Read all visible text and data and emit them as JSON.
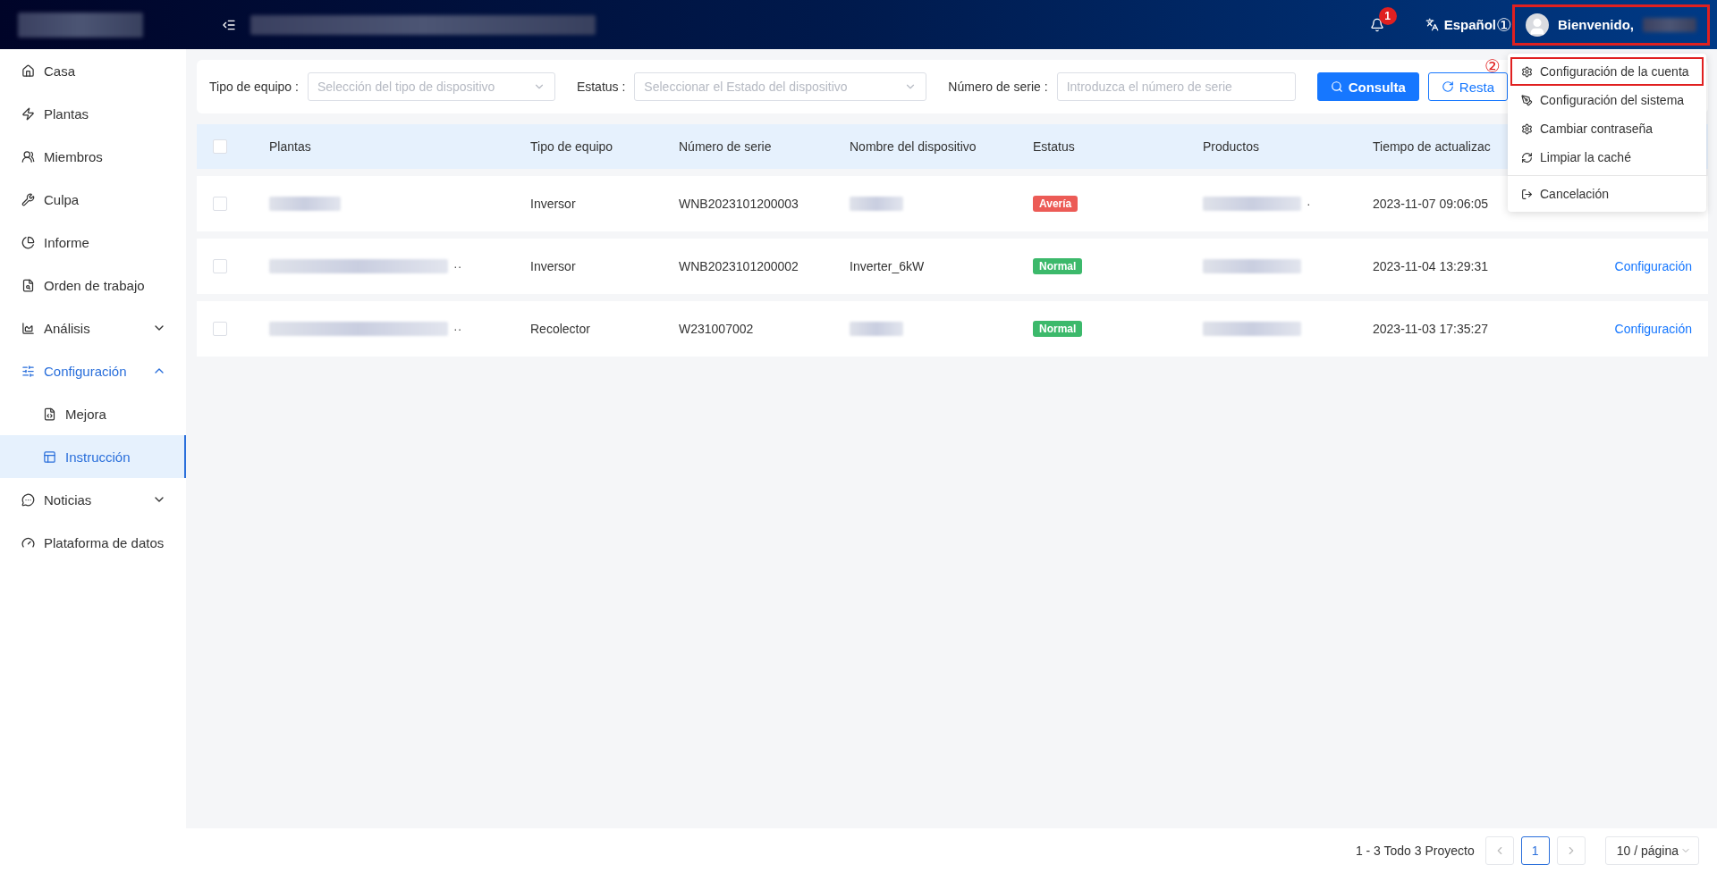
{
  "header": {
    "notification_count": "1",
    "language": "Español",
    "welcome": "Bienvenido,",
    "user_marked": true,
    "annotation_user": "①"
  },
  "sidebar": {
    "items": [
      {
        "label": "Casa",
        "selected": false
      },
      {
        "label": "Plantas",
        "selected": false
      },
      {
        "label": "Miembros",
        "selected": false
      },
      {
        "label": "Culpa",
        "selected": false
      },
      {
        "label": "Informe",
        "selected": false
      },
      {
        "label": "Orden de trabajo",
        "selected": false
      },
      {
        "label": "Análisis",
        "selected": false,
        "expanded": false
      },
      {
        "label": "Configuración",
        "selected": true,
        "expanded": true,
        "children": [
          {
            "label": "Mejora",
            "selected": false
          },
          {
            "label": "Instrucción",
            "selected": true
          }
        ]
      },
      {
        "label": "Noticias",
        "selected": false,
        "expanded": false
      },
      {
        "label": "Plataforma de datos",
        "selected": false
      }
    ]
  },
  "filters": [
    {
      "label": "Tipo de equipo :",
      "kind": "select",
      "placeholder": "Selección del tipo de dispositivo"
    },
    {
      "label": "Estatus :",
      "kind": "select",
      "placeholder": "Seleccionar el Estado del dispositivo"
    },
    {
      "label": "Número de serie :",
      "kind": "input",
      "placeholder": "Introduzca el número de serie"
    }
  ],
  "buttons": [
    {
      "label": "Consulta",
      "kind": "primary"
    },
    {
      "label": "Resta",
      "kind": "outline"
    }
  ],
  "table": {
    "header_checked": false,
    "columns": [
      "Plantas",
      "Tipo de equipo",
      "Número de serie",
      "Nombre del dispositivo",
      "Estatus",
      "Productos",
      "Tiempo de actualizac"
    ],
    "rows": [
      {
        "checked": false,
        "plant_suffix": "",
        "product_suffix": "·",
        "type": "Inversor",
        "serial": "WNB2023101200003",
        "device": "",
        "status": {
          "text": "Avería",
          "color": "#ec5b56"
        },
        "updated": "2023-11-07 09:06:05",
        "action": ""
      },
      {
        "checked": false,
        "plant_suffix": "··",
        "product_suffix": "",
        "type": "Inversor",
        "serial": "WNB2023101200002",
        "device": "Inverter_6kW",
        "status": {
          "text": "Normal",
          "color": "#3cb96b"
        },
        "updated": "2023-11-04 13:29:31",
        "action": "Configuración"
      },
      {
        "checked": false,
        "plant_suffix": "··",
        "product_suffix": "",
        "type": "Recolector",
        "serial": "W231007002",
        "device": "",
        "status": {
          "text": "Normal",
          "color": "#3cb96b"
        },
        "updated": "2023-11-03 17:35:27",
        "action": "Configuración"
      }
    ]
  },
  "pagination": {
    "summary": "1 - 3 Todo 3 Proyecto",
    "pages": [
      {
        "label": "1",
        "selected": true
      }
    ],
    "page_size": "10 / página"
  },
  "user_menu": {
    "annotation": "②",
    "groups": [
      [
        {
          "label": "Configuración de la cuenta",
          "marked": true
        },
        {
          "label": "Configuración del sistema",
          "marked": false
        },
        {
          "label": "Cambiar contraseña",
          "marked": false
        },
        {
          "label": "Limpiar la caché",
          "marked": false
        }
      ],
      [
        {
          "label": "Cancelación",
          "marked": false
        }
      ]
    ]
  }
}
